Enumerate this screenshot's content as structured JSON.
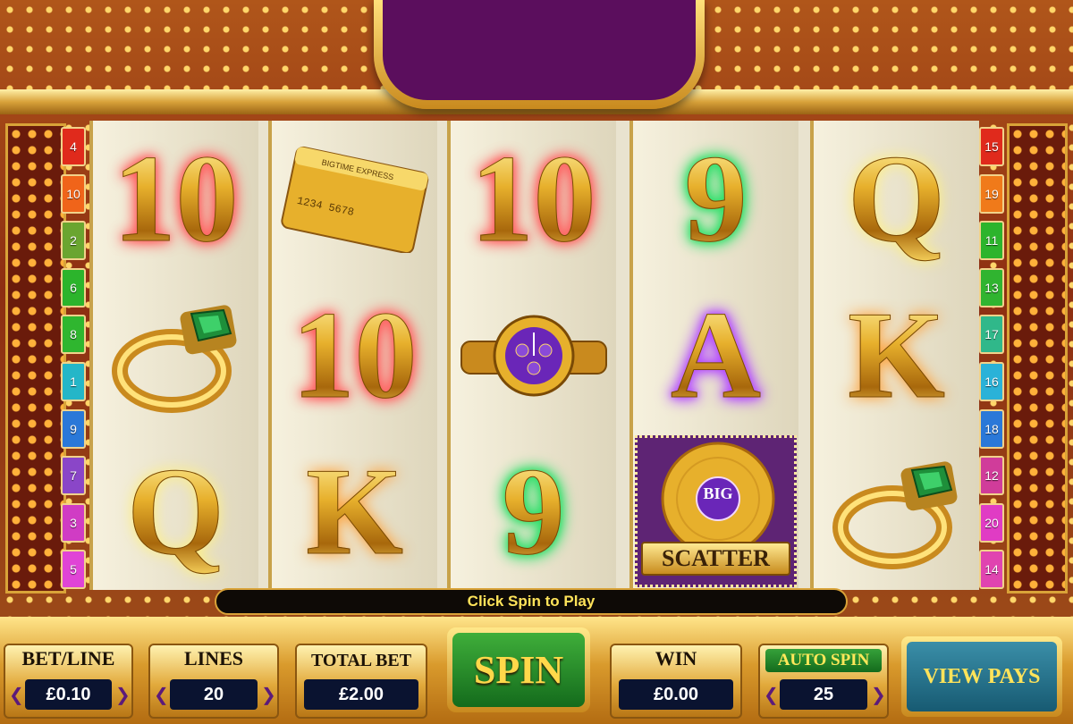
{
  "line_numbers_left": [
    {
      "n": "4",
      "color": "#e02a1c"
    },
    {
      "n": "10",
      "color": "#f0641a"
    },
    {
      "n": "2",
      "color": "#6aa530"
    },
    {
      "n": "6",
      "color": "#2cb42c"
    },
    {
      "n": "8",
      "color": "#2fb62f"
    },
    {
      "n": "1",
      "color": "#24b6c8"
    },
    {
      "n": "9",
      "color": "#2a78d8"
    },
    {
      "n": "7",
      "color": "#8a46c8"
    },
    {
      "n": "3",
      "color": "#d03cc4"
    },
    {
      "n": "5",
      "color": "#e044d6"
    }
  ],
  "line_numbers_right": [
    {
      "n": "15",
      "color": "#e02a1c"
    },
    {
      "n": "19",
      "color": "#f07a1a"
    },
    {
      "n": "11",
      "color": "#2cb42c"
    },
    {
      "n": "13",
      "color": "#30b430"
    },
    {
      "n": "17",
      "color": "#30b88a"
    },
    {
      "n": "16",
      "color": "#2ab2d8"
    },
    {
      "n": "18",
      "color": "#2a78d8"
    },
    {
      "n": "12",
      "color": "#d03c9a"
    },
    {
      "n": "20",
      "color": "#e03cc4"
    },
    {
      "n": "14",
      "color": "#e044b0"
    }
  ],
  "reels": [
    [
      {
        "kind": "text",
        "text": "10",
        "glow": "red",
        "icon": "ten-symbol"
      },
      {
        "kind": "ring",
        "icon": "emerald-ring-icon"
      },
      {
        "kind": "text",
        "text": "Q",
        "glow": "yellow",
        "icon": "queen-symbol"
      }
    ],
    [
      {
        "kind": "card",
        "icon": "credit-card-icon",
        "card_text": "BIGTIME EXPRESS"
      },
      {
        "kind": "text",
        "text": "10",
        "glow": "red",
        "icon": "ten-symbol"
      },
      {
        "kind": "text",
        "text": "K",
        "glow": "orange",
        "icon": "king-symbol"
      }
    ],
    [
      {
        "kind": "text",
        "text": "10",
        "glow": "red",
        "icon": "ten-symbol"
      },
      {
        "kind": "watch",
        "icon": "gold-watch-icon"
      },
      {
        "kind": "text",
        "text": "9",
        "glow": "green",
        "icon": "nine-symbol"
      }
    ],
    [
      {
        "kind": "text",
        "text": "9",
        "glow": "green",
        "icon": "nine-symbol"
      },
      {
        "kind": "text",
        "text": "A",
        "glow": "purple",
        "icon": "ace-symbol"
      },
      {
        "kind": "scatter",
        "icon": "gold-record-scatter-icon",
        "badge": "BIG",
        "label": "SCATTER"
      }
    ],
    [
      {
        "kind": "text",
        "text": "Q",
        "glow": "yellow",
        "icon": "queen-symbol"
      },
      {
        "kind": "text",
        "text": "K",
        "glow": "orange",
        "icon": "king-symbol"
      },
      {
        "kind": "ring",
        "icon": "emerald-ring-icon"
      }
    ]
  ],
  "message": "Click Spin to Play",
  "controls": {
    "bet_line": {
      "title": "BET/LINE",
      "value": "£0.10",
      "left_arrow": "❮",
      "right_arrow": "❯"
    },
    "lines": {
      "title": "LINES",
      "value": "20",
      "left_arrow": "❮",
      "right_arrow": "❯"
    },
    "total_bet": {
      "title": "TOTAL BET",
      "value": "£2.00"
    },
    "spin": {
      "label": "SPIN"
    },
    "win": {
      "title": "WIN",
      "value": "£0.00"
    },
    "auto_spin": {
      "title": "AUTO SPIN",
      "value": "25",
      "left_arrow": "❮",
      "right_arrow": "❯"
    },
    "view_pays": {
      "label": "VIEW PAYS"
    }
  },
  "colors": {
    "accent_gold": "#e2aa3c",
    "spin_green": "#146b1c",
    "display_navy": "#0a1330",
    "top_sign_purple": "#5b0e5d"
  }
}
